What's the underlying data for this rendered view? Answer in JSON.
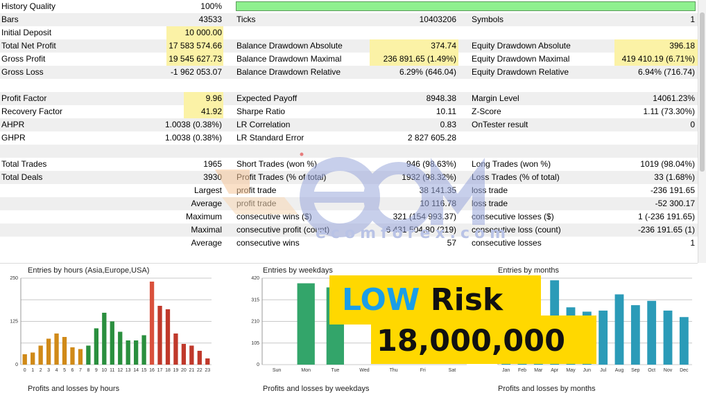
{
  "report": {
    "rows": [
      {
        "a_label": "History Quality",
        "a_value": "100%",
        "has_quality_bar": true,
        "quality": 1.0
      },
      {
        "a_label": "Bars",
        "a_value": "43533",
        "b_label": "Ticks",
        "b_value": "10403206",
        "c_label": "Symbols",
        "c_value": "1"
      },
      {
        "a_label": "Initial Deposit",
        "a_value": "10 000.00"
      },
      {
        "a_label": "Total Net Profit",
        "a_value": "17 583 574.66",
        "b_label": "Balance Drawdown Absolute",
        "b_value": "374.74",
        "c_label": "Equity Drawdown Absolute",
        "c_value": "396.18"
      },
      {
        "a_label": "Gross Profit",
        "a_value": "19 545 627.73",
        "b_label": "Balance Drawdown Maximal",
        "b_value": "236 891.65 (1.49%)",
        "c_label": "Equity Drawdown Maximal",
        "c_value": "419 410.19 (6.71%)"
      },
      {
        "a_label": "Gross Loss",
        "a_value": "-1 962 053.07",
        "b_label": "Balance Drawdown Relative",
        "b_value": "6.29% (646.04)",
        "c_label": "Equity Drawdown Relative",
        "c_value": "6.94% (716.74)"
      },
      {},
      {
        "a_label": "Profit Factor",
        "a_value": "9.96",
        "b_label": "Expected Payoff",
        "b_value": "8948.38",
        "c_label": "Margin Level",
        "c_value": "14061.23%"
      },
      {
        "a_label": "Recovery Factor",
        "a_value": "41.92",
        "b_label": "Sharpe Ratio",
        "b_value": "10.11",
        "c_label": "Z-Score",
        "c_value": "1.11 (73.30%)"
      },
      {
        "a_label": "AHPR",
        "a_value": "1.0038 (0.38%)",
        "b_label": "LR Correlation",
        "b_value": "0.83",
        "c_label": "OnTester result",
        "c_value": "0"
      },
      {
        "a_label": "GHPR",
        "a_value": "1.0038 (0.38%)",
        "b_label": "LR Standard Error",
        "b_value": "2 827 605.28"
      },
      {},
      {
        "a_label": "Total Trades",
        "a_value": "1965",
        "b_label": "Short Trades (won %)",
        "b_value": "946 (98.63%)",
        "c_label": "Long Trades (won %)",
        "c_value": "1019 (98.04%)"
      },
      {
        "a_label": "Total Deals",
        "a_value": "3930",
        "b_label": "Profit Trades (% of total)",
        "b_value": "1932 (98.32%)",
        "c_label": "Loss Trades (% of total)",
        "c_value": "33 (1.68%)"
      },
      {
        "a_value": "Largest",
        "b_label": "profit trade",
        "b_value": "38 141.35",
        "c_label": "loss trade",
        "c_value": "-236 191.65"
      },
      {
        "a_value": "Average",
        "b_label": "profit trade",
        "b_value": "10 116.78",
        "c_label": "loss trade",
        "c_value": "-52 300.17"
      },
      {
        "a_value": "Maximum",
        "b_label": "consecutive wins ($)",
        "b_value": "321 (154 993.37)",
        "c_label": "consecutive losses ($)",
        "c_value": "1 (-236 191.65)"
      },
      {
        "a_value": "Maximal",
        "b_label": "consecutive profit (count)",
        "b_value": "6 431 504.80 (219)",
        "c_label": "consecutive loss (count)",
        "c_value": "-236 191.65 (1)"
      },
      {
        "a_value": "Average",
        "b_label": "consecutive wins",
        "b_value": "57",
        "c_label": "consecutive losses",
        "c_value": "1"
      }
    ]
  },
  "chart_data": [
    {
      "type": "bar",
      "title": "Entries by hours (Asia,Europe,USA)",
      "footer": "Profits and losses by hours",
      "ylim": [
        0,
        250
      ],
      "yticks": [
        "250",
        "125",
        "0"
      ],
      "categories": [
        "0",
        "1",
        "2",
        "3",
        "4",
        "5",
        "6",
        "7",
        "8",
        "9",
        "10",
        "11",
        "12",
        "13",
        "14",
        "15",
        "16",
        "17",
        "18",
        "19",
        "20",
        "21",
        "22",
        "23"
      ],
      "values": [
        30,
        35,
        55,
        75,
        90,
        80,
        50,
        45,
        55,
        105,
        150,
        125,
        95,
        70,
        70,
        85,
        240,
        170,
        160,
        90,
        60,
        55,
        40,
        18
      ],
      "colors": [
        "#d08a18",
        "#d08a18",
        "#d08a18",
        "#d08a18",
        "#d08a18",
        "#d08a18",
        "#d08a18",
        "#d08a18",
        "#2a8f3e",
        "#2a8f3e",
        "#2a8f3e",
        "#2a8f3e",
        "#2a8f3e",
        "#2a8f3e",
        "#2a8f3e",
        "#2a8f3e",
        "#d9513c",
        "#c0392b",
        "#c0392b",
        "#c0392b",
        "#c0392b",
        "#c0392b",
        "#c0392b",
        "#c0392b"
      ]
    },
    {
      "type": "bar",
      "title": "Entries by weekdays",
      "footer": "Profits and losses by weekdays",
      "ylim": [
        0,
        420
      ],
      "yticks": [
        "420",
        "315",
        "210",
        "105",
        "0"
      ],
      "categories": [
        "Sun",
        "Mon",
        "Tue",
        "Wed",
        "Thu",
        "Fri",
        "Sat"
      ],
      "values": [
        0,
        395,
        375,
        0,
        0,
        0,
        0
      ],
      "colors": [
        "#33a56a",
        "#33a56a",
        "#33a56a",
        "#33a56a",
        "#33a56a",
        "#33a56a",
        "#33a56a"
      ]
    },
    {
      "type": "bar",
      "title": "Entries by months",
      "footer": "Profits and losses by months",
      "ylim": [
        0,
        400
      ],
      "yticks": [],
      "categories": [
        "Jan",
        "Feb",
        "Mar",
        "Apr",
        "May",
        "Jun",
        "Jul",
        "Aug",
        "Sep",
        "Oct",
        "Nov",
        "Dec"
      ],
      "values": [
        150,
        160,
        170,
        390,
        265,
        245,
        250,
        325,
        275,
        295,
        250,
        220
      ],
      "colors": [
        "#2b9bb8",
        "#2b9bb8",
        "#2b9bb8",
        "#2b9bb8",
        "#2b9bb8",
        "#2b9bb8",
        "#2b9bb8",
        "#2b9bb8",
        "#2b9bb8",
        "#2b9bb8",
        "#2b9bb8",
        "#2b9bb8"
      ]
    }
  ],
  "overlay": {
    "watermark_url": "ecomforex.com",
    "banner_low": "LOW",
    "banner_risk": "Risk",
    "banner_amount": "18,000,000",
    "colors": {
      "banner": "#ffd800",
      "low": "#1a9ee8"
    }
  }
}
